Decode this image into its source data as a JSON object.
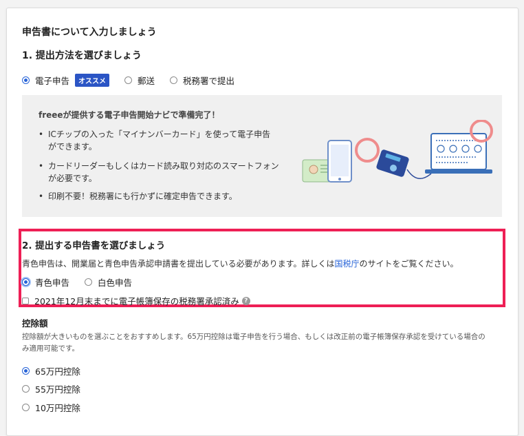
{
  "page": {
    "title": "申告書について入力しましょう"
  },
  "section1": {
    "title": "1. 提出方法を選びましょう",
    "options": [
      {
        "label": "電子申告",
        "selected": true,
        "badge": "オススメ"
      },
      {
        "label": "郵送",
        "selected": false
      },
      {
        "label": "税務署で提出",
        "selected": false
      }
    ]
  },
  "navi": {
    "title": "freeeが提供する電子申告開始ナビで準備完了！",
    "bullets": [
      {
        "line1": "ICチップの入った「マイナンバーカード」を使って電子申告",
        "line2": "ができます。"
      },
      {
        "line1": "カードリーダーもしくはカード読み取り対応のスマートフォン",
        "line2": "が必要です。"
      },
      {
        "line1": "印刷不要！税務署にも行かずに確定申告できます。",
        "line2": ""
      }
    ],
    "illustration_colors": {
      "accent_circle": "#ef8c8c",
      "screen": "#3a6fb8",
      "card": "#c8e6c0",
      "reader": "#2b4a9a"
    }
  },
  "section2": {
    "title": "2. 提出する申告書を選びましょう",
    "desc_prefix": "青色申告は、開業届と青色申告承認申請書を提出している必要があります。詳しくは",
    "desc_link": "国税庁",
    "desc_suffix": "のサイトをご覧ください。",
    "options": [
      {
        "label": "青色申告",
        "selected": true
      },
      {
        "label": "白色申告",
        "selected": false
      }
    ],
    "checkbox_label": "2021年12月末までに電子帳簿保存の税務署承認済み",
    "help_icon": "?"
  },
  "deduction": {
    "title": "控除額",
    "desc_line1": "控除額が大きいものを選ぶことをおすすめします。65万円控除は電子申告を行う場合、もしくは改正前の電子帳簿保存承認を受けている場合の",
    "desc_line2": "み適用可能です。",
    "options": [
      {
        "label": "65万円控除",
        "selected": true
      },
      {
        "label": "55万円控除",
        "selected": false
      },
      {
        "label": "10万円控除",
        "selected": false
      }
    ]
  },
  "colors": {
    "highlight_border": "#ee1f55",
    "radio_selected": "#2864d8",
    "badge_bg": "#2b55c5"
  }
}
